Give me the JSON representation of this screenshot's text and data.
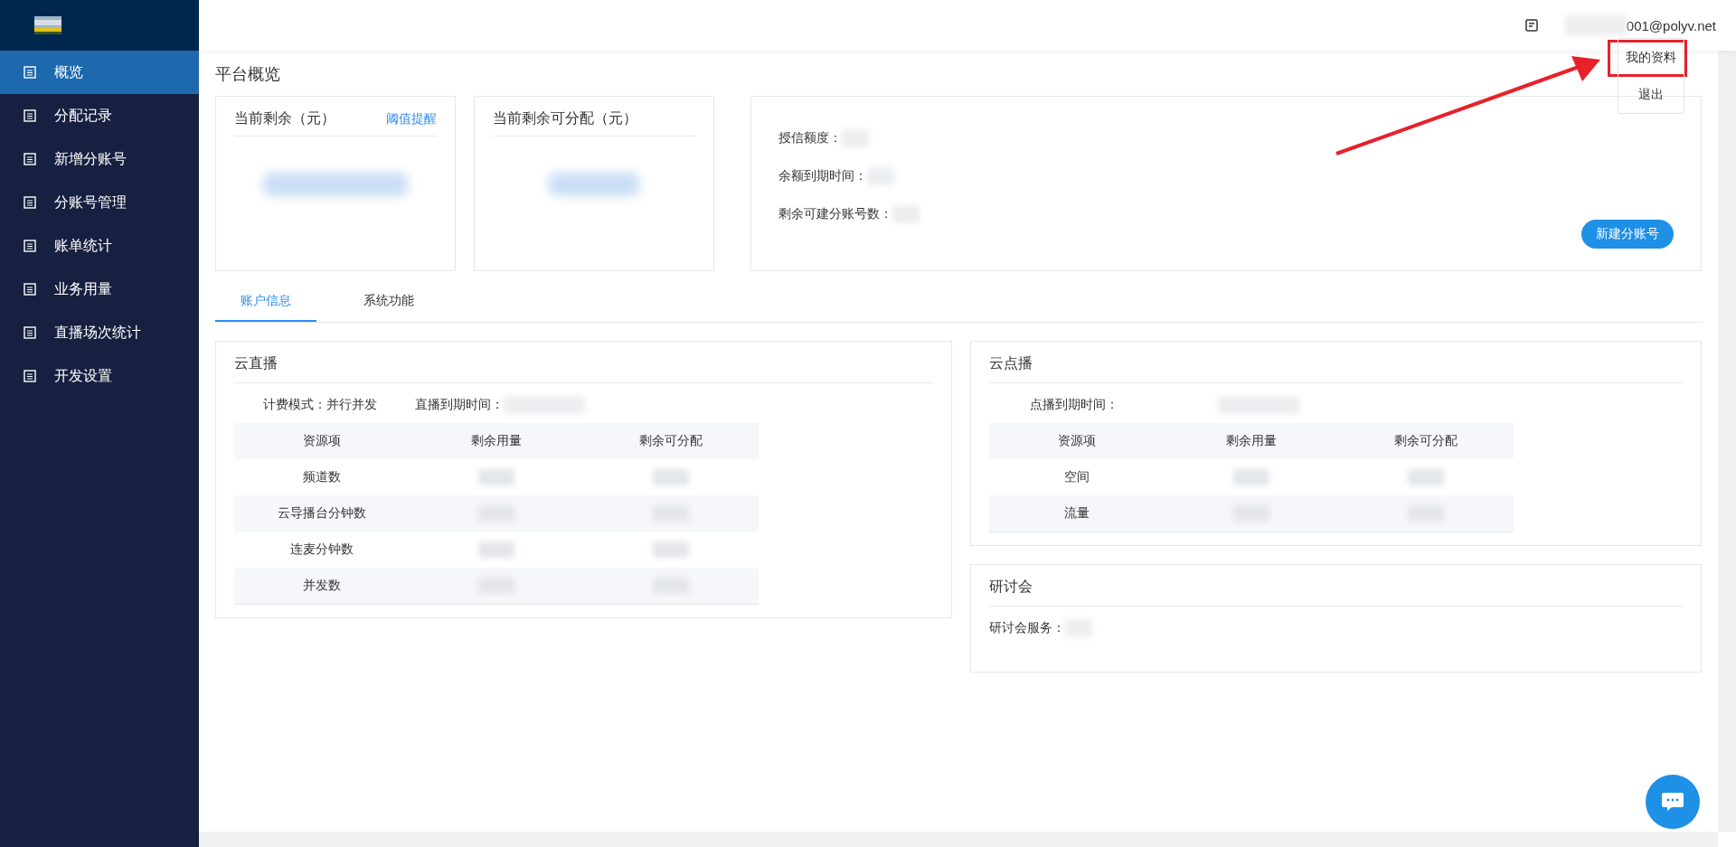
{
  "sidebar": {
    "items": [
      {
        "label": "概览",
        "selected": true
      },
      {
        "label": "分配记录",
        "selected": false
      },
      {
        "label": "新增分账号",
        "selected": false
      },
      {
        "label": "分账号管理",
        "selected": false
      },
      {
        "label": "账单统计",
        "selected": false
      },
      {
        "label": "业务用量",
        "selected": false
      },
      {
        "label": "直播场次统计",
        "selected": false
      },
      {
        "label": "开发设置",
        "selected": false
      }
    ]
  },
  "header": {
    "user_email": "001@polyv.net",
    "user_menu": [
      "我的资料",
      "退出"
    ]
  },
  "page_title": "平台概览",
  "balance_card": {
    "title": "当前剩余（元）",
    "link": "阈值提醒"
  },
  "allocatable_card": {
    "title": "当前剩余可分配（元）"
  },
  "credit_card": {
    "fields": [
      "授信额度：",
      "余额到期时间：",
      "剩余可建分账号数："
    ],
    "button": "新建分账号"
  },
  "tabs": [
    {
      "label": "账户信息",
      "selected": true
    },
    {
      "label": "系统功能",
      "selected": false
    }
  ],
  "live_card": {
    "title": "云直播",
    "info": [
      "计费模式：并行并发",
      "直播到期时间："
    ],
    "columns": [
      "资源项",
      "剩余用量",
      "剩余可分配"
    ],
    "rows": [
      "频道数",
      "云导播台分钟数",
      "连麦分钟数",
      "并发数"
    ]
  },
  "vod_card": {
    "title": "云点播",
    "info": [
      "点播到期时间："
    ],
    "columns": [
      "资源项",
      "剩余用量",
      "剩余可分配"
    ],
    "rows": [
      "空间",
      "流量"
    ]
  },
  "seminar_card": {
    "title": "研讨会",
    "field": "研讨会服务："
  }
}
